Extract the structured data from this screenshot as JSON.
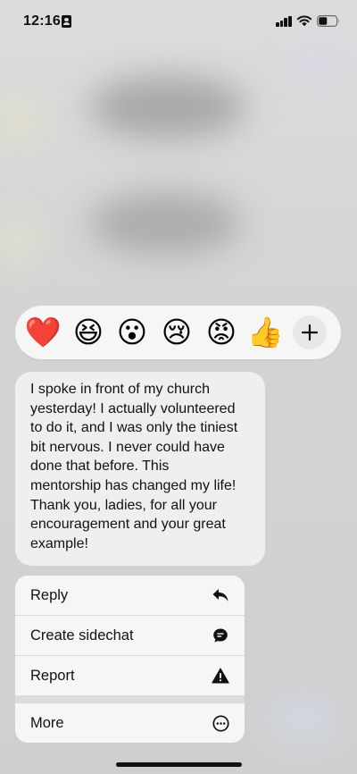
{
  "status_bar": {
    "time": "12:16",
    "icons": [
      "id-card-icon",
      "signal-icon",
      "wifi-icon",
      "battery-icon"
    ]
  },
  "reactions": [
    {
      "emoji": "❤️",
      "name": "heart"
    },
    {
      "emoji": "😆",
      "name": "laughing"
    },
    {
      "emoji": "😮",
      "name": "wow"
    },
    {
      "emoji": "😢",
      "name": "sad"
    },
    {
      "emoji": "😡",
      "name": "angry"
    },
    {
      "emoji": "👍",
      "name": "thumbs-up"
    }
  ],
  "add_reaction_icon": "plus-icon",
  "message": {
    "text": "I spoke in front of my church\nyesterday! I actually volunteered\nto do it, and I was only the tiniest\nbit nervous. I never could have\ndone that before. This\nmentorship has changed my life!\nThank you, ladies, for all your\nencouragement and your great\nexample!"
  },
  "menu": {
    "items": [
      {
        "label": "Reply",
        "icon": "reply-arrow-icon"
      },
      {
        "label": "Create sidechat",
        "icon": "chat-bubble-icon"
      },
      {
        "label": "Report",
        "icon": "warning-triangle-icon"
      },
      {
        "label": "More",
        "icon": "more-circle-icon"
      }
    ]
  },
  "colors": {
    "bubble": "#efefef",
    "menu_background": "#f6f6f6",
    "backdrop": "#d6d6d6",
    "text": "#111111"
  }
}
